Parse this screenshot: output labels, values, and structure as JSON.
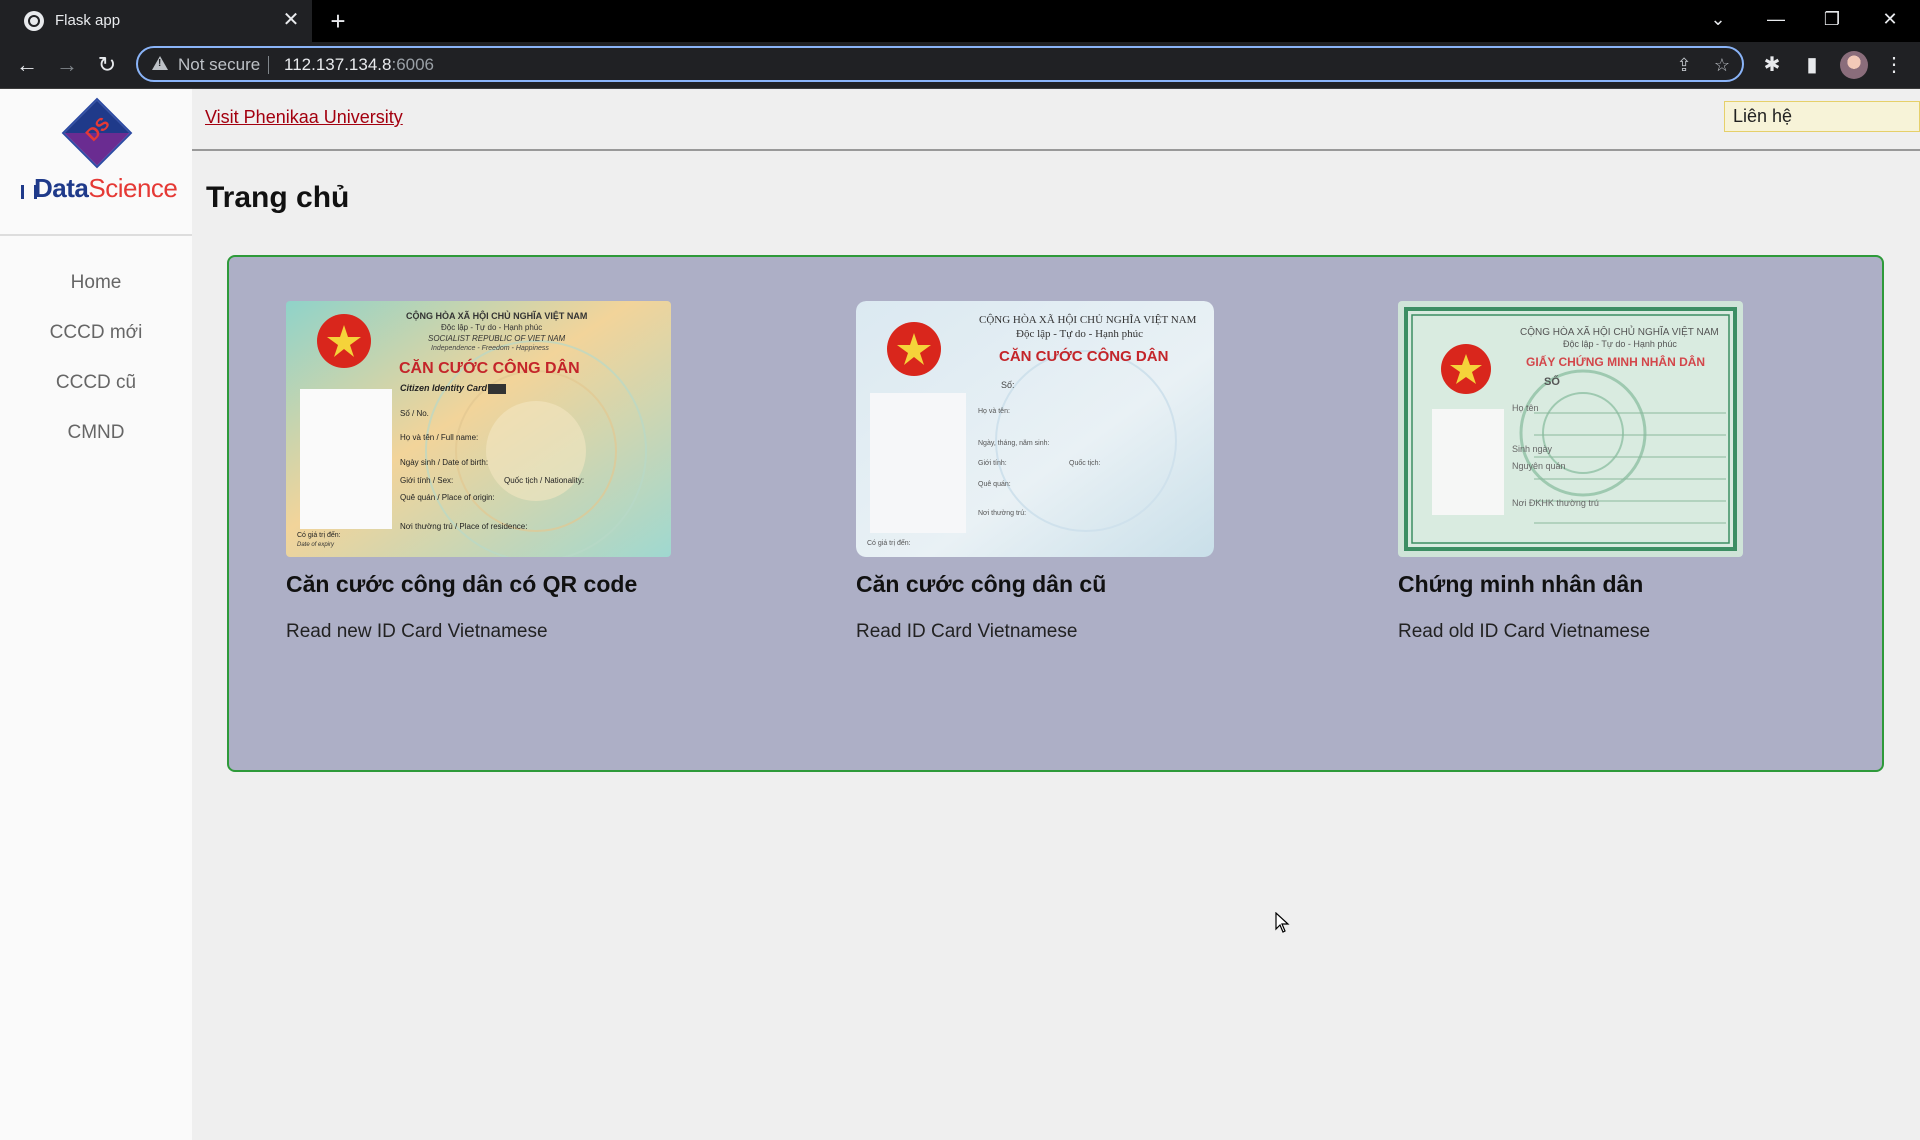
{
  "browser": {
    "tab_title": "Flask app",
    "tab_close": "✕",
    "new_tab": "+",
    "security_label": "Not secure",
    "url_host": "112.137.134.8",
    "url_port": ":6006"
  },
  "header": {
    "link_text": "Visit Phenikaa University",
    "contact_value": "Liên hệ"
  },
  "logo": {
    "mark": "DS",
    "brand_part1": "Data",
    "brand_part2": "Science"
  },
  "sidebar": {
    "items": [
      {
        "label": "Home"
      },
      {
        "label": "CCCD mới"
      },
      {
        "label": "CCCD cũ"
      },
      {
        "label": "CMND"
      }
    ]
  },
  "main": {
    "title": "Trang chủ",
    "cards": [
      {
        "title": "Căn cước công dân có QR code",
        "description": "Read new ID Card Vietnamese",
        "card_header_line1": "CỘNG HÒA XÃ HỘI CHỦ NGHĨA VIỆT NAM",
        "card_header_line2": "Độc lập - Tự do - Hạnh phúc",
        "card_header_line3": "SOCIALIST REPUBLIC OF VIET NAM",
        "card_header_line4": "Independence - Freedom - Happiness",
        "card_heading": "CĂN CƯỚC CÔNG DÂN",
        "card_subheading": "Citizen Identity Card",
        "field_1": "Số / No.",
        "field_2": "Họ và tên / Full name:",
        "field_3": "Ngày sinh / Date of birth:",
        "field_4": "Giới tính / Sex:",
        "field_4b": "Quốc tịch / Nationality:",
        "field_5": "Quê quán / Place of origin:",
        "field_6": "Nơi thường trú / Place of residence:",
        "field_7": "Có giá trị đến:",
        "field_7b": "Date of expiry"
      },
      {
        "title": "Căn cước công dân cũ",
        "description": "Read ID Card Vietnamese",
        "card_header_line1": "CỘNG HÒA XÃ HỘI CHỦ NGHĨA VIỆT NAM",
        "card_header_line2": "Độc lập - Tự do - Hạnh phúc",
        "card_heading": "CĂN CƯỚC CÔNG DÂN",
        "field_1": "Số:",
        "field_2": "Họ và tên:",
        "field_3": "Ngày, tháng, năm sinh:",
        "field_4": "Giới tính:",
        "field_4b": "Quốc tịch:",
        "field_5": "Quê quán:",
        "field_6": "Nơi thường trú:",
        "field_7": "Có giá trị đến:"
      },
      {
        "title": "Chứng minh nhân dân",
        "description": "Read old ID Card Vietnamese",
        "card_header_line1": "CỘNG HÒA XÃ HỘI CHỦ NGHĨA VIỆT NAM",
        "card_header_line2": "Độc lập - Tự do - Hạnh phúc",
        "card_heading": "GIẤY CHỨNG MINH NHÂN DÂN",
        "field_1": "SỐ",
        "field_2": "Họ tên",
        "field_3": "Sinh ngày",
        "field_4": "Nguyên quán",
        "field_5": "Nơi ĐKHK thường trú"
      }
    ]
  },
  "colors": {
    "panel_bg": "#adafc6",
    "panel_border": "#2e9a3a",
    "link": "#a3000f",
    "brand_blue": "#1f3a8a",
    "brand_red": "#e53935"
  }
}
